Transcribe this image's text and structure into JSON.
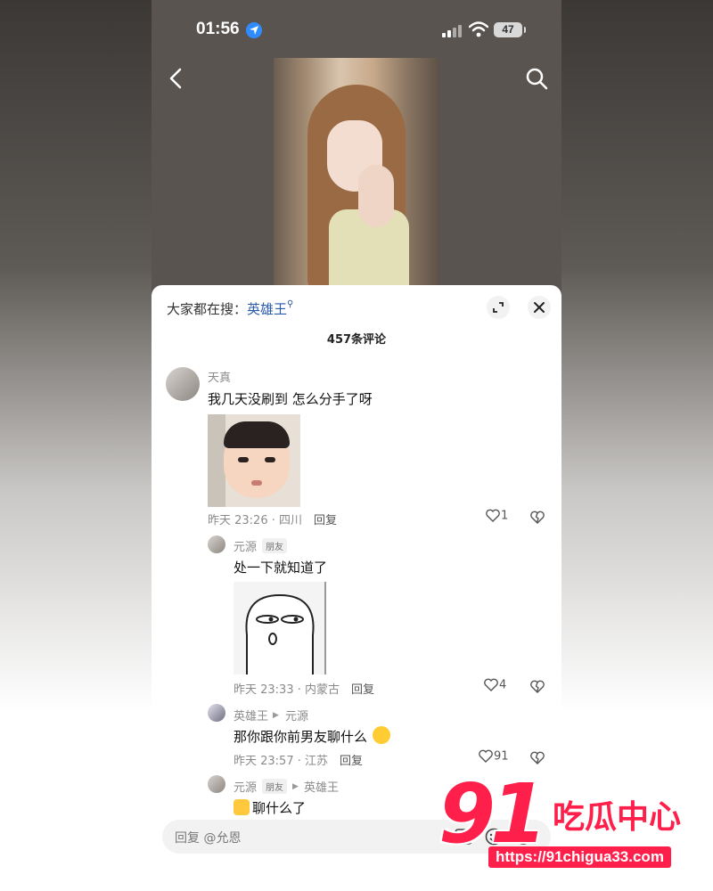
{
  "status_bar": {
    "time": "01:56",
    "battery": "47"
  },
  "comments_panel": {
    "trending_prefix": "大家都在搜：",
    "trending_keyword": "英雄王",
    "count_label": "457条评论"
  },
  "comments": [
    {
      "user": "天真",
      "text": "我几天没刷到 怎么分手了呀",
      "meta": "昨天 23:26 · 四川",
      "reply_label": "回复",
      "likes": "1"
    }
  ],
  "replies": [
    {
      "user": "元源",
      "badge": "朋友",
      "text": "处一下就知道了",
      "meta": "昨天 23:33 · 内蒙古",
      "reply_label": "回复",
      "likes": "4"
    },
    {
      "user": "英雄王",
      "reply_to": "元源",
      "text": "那你跟你前男友聊什么",
      "meta": "昨天 23:57 · 江苏",
      "reply_label": "回复",
      "likes": "91"
    },
    {
      "user": "元源",
      "badge": "朋友",
      "reply_to": "英雄王",
      "text": "聊什么了"
    }
  ],
  "input": {
    "placeholder": "回复 @允恩"
  },
  "watermark": {
    "number": "91",
    "brand": "吃瓜中心",
    "url": "https://91chigua33.com"
  },
  "colors": {
    "accent_link": "#2b5aa8",
    "watermark": "#ff1f4b"
  }
}
